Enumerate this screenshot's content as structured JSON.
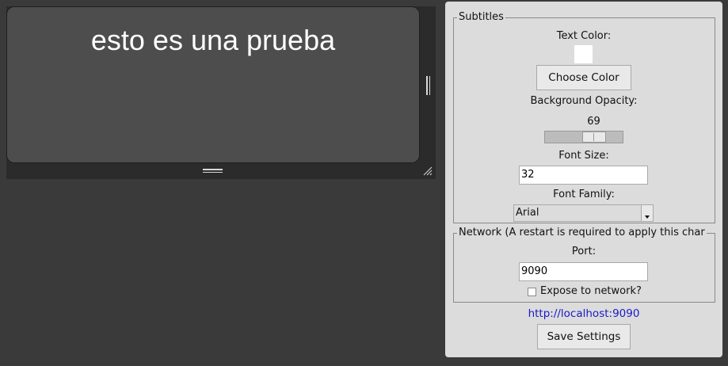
{
  "preview": {
    "subtitle_text": "esto es una prueba"
  },
  "settings": {
    "subtitles": {
      "legend": "Subtitles",
      "text_color_label": "Text Color:",
      "text_color_value": "#ffffff",
      "choose_color_button": "Choose Color",
      "bg_opacity_label": "Background Opacity:",
      "bg_opacity_value": "69",
      "bg_opacity_fraction": 0.69,
      "font_size_label": "Font Size:",
      "font_size_value": "32",
      "font_family_label": "Font Family:",
      "font_family_value": "Arial"
    },
    "network": {
      "legend": "Network (A restart is required to apply this char",
      "port_label": "Port:",
      "port_value": "9090",
      "expose_label": "Expose to network?",
      "expose_checked": false
    },
    "url_link": "http://localhost:9090",
    "save_button": "Save Settings"
  },
  "colors": {
    "desktop_background": "#3a3a3a",
    "preview_background": "#4d4d4d",
    "panel_background": "#dcdcdc",
    "link": "#1a1ac8"
  },
  "icons": {
    "vertical_grip": "vertical-resize-grip-icon",
    "horizontal_grip": "horizontal-resize-grip-icon",
    "corner_grip": "corner-resize-grip-icon",
    "dropdown_arrow": "chevron-down-icon"
  }
}
